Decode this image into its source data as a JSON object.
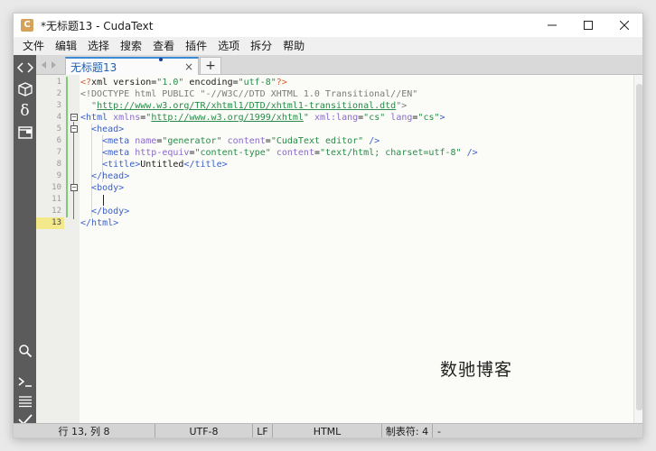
{
  "window": {
    "title": "*无标题13 - CudaText",
    "app_icon_letter": "C"
  },
  "menu": [
    "文件",
    "编辑",
    "选择",
    "搜索",
    "查看",
    "插件",
    "选项",
    "拆分",
    "帮助"
  ],
  "sidebar": {
    "top_icons": [
      "code-tree-icon",
      "project-icon",
      "snippet-icon",
      "tabs-icon"
    ],
    "bottom_icons": [
      "search-icon",
      "console-icon",
      "output-list-icon",
      "validate-icon"
    ]
  },
  "tabs": [
    {
      "label": "无标题13",
      "close": "×",
      "modified": true
    }
  ],
  "tab_add_label": "+",
  "editor": {
    "current_line": 13,
    "line_numbers": [
      "1",
      "2",
      "3",
      "4",
      "5",
      "6",
      "7",
      "8",
      "9",
      "10",
      "11",
      "12",
      "13"
    ]
  },
  "watermark": "数驰博客",
  "status": {
    "position": "行 13, 列 8",
    "encoding": "UTF-8",
    "line_ending": "LF",
    "lexer": "HTML",
    "tab_size": "制表符: 4",
    "extra": "-"
  }
}
